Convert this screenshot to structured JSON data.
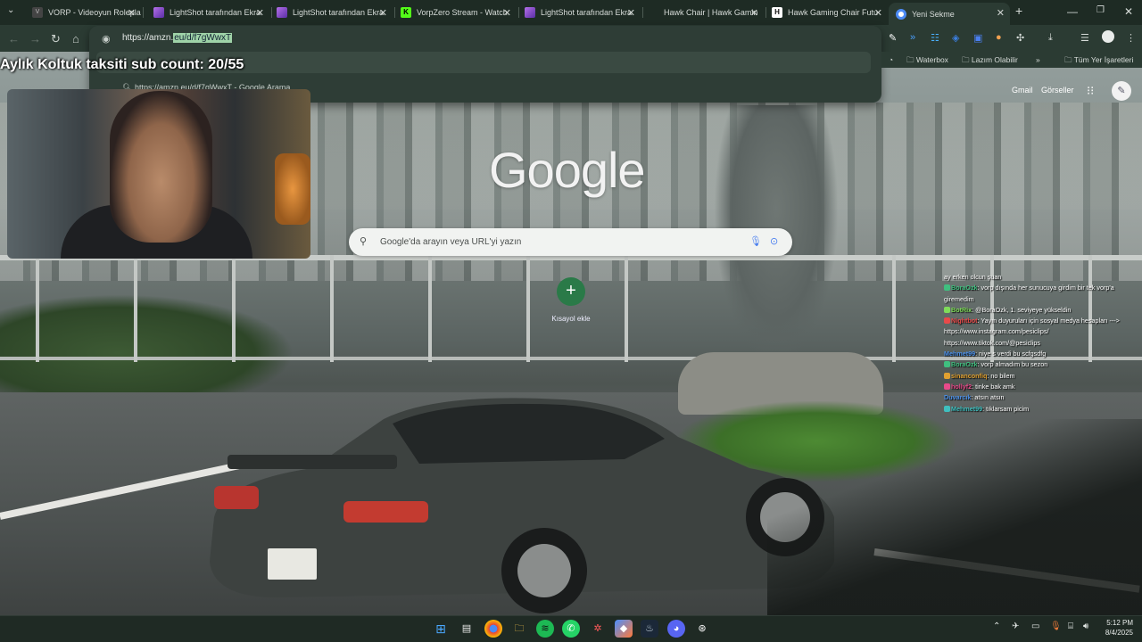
{
  "browser": {
    "tabs": [
      {
        "label": "VORP - Videoyun Rolepla",
        "active": false
      },
      {
        "label": "LightShot tarafından Ekra",
        "active": false
      },
      {
        "label": "LightShot tarafından Ekra",
        "active": false
      },
      {
        "label": "VorpZero Stream - Watch",
        "active": false
      },
      {
        "label": "LightShot tarafından Ekra",
        "active": false
      },
      {
        "label": "Hawk Chair | Hawk Gamin",
        "active": false
      },
      {
        "label": "Hawk Gaming Chair Futu",
        "active": false
      },
      {
        "label": "Yeni Sekme",
        "active": true
      }
    ],
    "url_prefix": "https://amzn.",
    "url_selected": "eu/d/f7gWwxT",
    "suggestion": "https://amzn.eu/d/f7gWwxT - Google Arama",
    "bookmarks": [
      "Waterbox",
      "Lazım Olabilir",
      "Tüm Yer İşaretleri"
    ]
  },
  "overlay": {
    "title": "Aylık Koltuk taksiti sub count: 20/55"
  },
  "ntp": {
    "gmail": "Gmail",
    "images": "Görseller",
    "logo": "Google",
    "search_placeholder": "Google'da arayın veya URL'yi yazın",
    "shortcut_label": "Kısayol ekle"
  },
  "chat": [
    {
      "user": "",
      "text": "ay erken olcun şuan",
      "color": "#ffffff"
    },
    {
      "user": "BoraOzk",
      "text": ": vorp dışında her sunucuya girdim bir tek vorp'a",
      "color": "#3fbf7f"
    },
    {
      "user": "",
      "text": "giremedim",
      "color": "#ffffff"
    },
    {
      "user": "BotRix",
      "text": ": @BoraOzk, 1. seviyeye yükseldin",
      "color": "#7fdc5a"
    },
    {
      "user": "Nightbot",
      "text": ": Yayın duyuruları için sosyal medya hesapları --->",
      "color": "#e84a4a"
    },
    {
      "user": "",
      "text": "https://www.instagram.com/pesiclips/",
      "color": "#ffffff"
    },
    {
      "user": "",
      "text": "https://www.tiktok.com/@pesiclips",
      "color": "#ffffff"
    },
    {
      "user": "Mehmet99",
      "text": ": niye s verdi bu scfgsdfg",
      "color": "#4a8fe8"
    },
    {
      "user": "BoraOzk",
      "text": ": vorp almadım bu sezon",
      "color": "#3fbf7f"
    },
    {
      "user": "sinanconfiq",
      "text": ": no bilem",
      "color": "#e0a030"
    },
    {
      "user": "hollyf2",
      "text": ": tinke bak amk",
      "color": "#e84a8a"
    },
    {
      "user": "Duvarcık",
      "text": ": atsın atsın",
      "color": "#4a8fe8"
    },
    {
      "user": "Mehmet99",
      "text": ": tıklarsam picim",
      "color": "#3fbfbf"
    }
  ],
  "system": {
    "time": "5:12 PM",
    "date": "8/4/2025"
  },
  "colors": {
    "accent_green": "#2a7a48",
    "tab_bar": "#1e2b24"
  }
}
